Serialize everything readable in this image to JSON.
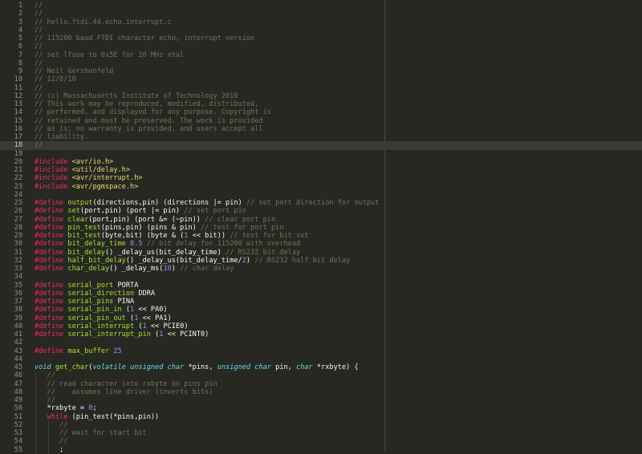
{
  "editor": {
    "theme_colors": {
      "background": "#272822",
      "comment": "#75715e",
      "keyword": "#f92672",
      "string": "#e6db74",
      "function": "#a6e22e",
      "number": "#ae81ff",
      "type": "#66d9ef",
      "text": "#f8f8f2"
    },
    "active_line": 18,
    "lines": [
      {
        "n": "1",
        "t": [
          [
            "c",
            "//"
          ]
        ]
      },
      {
        "n": "2",
        "t": [
          [
            "c",
            "//"
          ]
        ]
      },
      {
        "n": "3",
        "t": [
          [
            "c",
            "// hello.ftdi.44.echo.interrupt.c"
          ]
        ]
      },
      {
        "n": "4",
        "t": [
          [
            "c",
            "//"
          ]
        ]
      },
      {
        "n": "5",
        "t": [
          [
            "c",
            "// 115200 baud FTDI character echo, interrupt version"
          ]
        ]
      },
      {
        "n": "6",
        "t": [
          [
            "c",
            "//"
          ]
        ]
      },
      {
        "n": "7",
        "t": [
          [
            "c",
            "// set lfuse to 0x5E for 20 MHz xtal"
          ]
        ]
      },
      {
        "n": "8",
        "t": [
          [
            "c",
            "//"
          ]
        ]
      },
      {
        "n": "9",
        "t": [
          [
            "c",
            "// Neil Gershenfeld"
          ]
        ]
      },
      {
        "n": "10",
        "t": [
          [
            "c",
            "// 12/8/10"
          ]
        ]
      },
      {
        "n": "11",
        "t": [
          [
            "c",
            "//"
          ]
        ]
      },
      {
        "n": "12",
        "t": [
          [
            "c",
            "// (c) Massachusetts Institute of Technology 2010"
          ]
        ]
      },
      {
        "n": "13",
        "t": [
          [
            "c",
            "// This work may be reproduced, modified, distributed,"
          ]
        ]
      },
      {
        "n": "14",
        "t": [
          [
            "c",
            "// performed, and displayed for any purpose. Copyright is"
          ]
        ]
      },
      {
        "n": "15",
        "t": [
          [
            "c",
            "// retained and must be preserved. The work is provided"
          ]
        ]
      },
      {
        "n": "16",
        "t": [
          [
            "c",
            "// as is; no warranty is provided, and users accept all"
          ]
        ]
      },
      {
        "n": "17",
        "t": [
          [
            "c",
            "// liability."
          ]
        ]
      },
      {
        "n": "18",
        "t": [
          [
            "c",
            "//"
          ]
        ]
      },
      {
        "n": "19",
        "t": []
      },
      {
        "n": "20",
        "t": [
          [
            "k",
            "#include"
          ],
          [
            "p",
            " "
          ],
          [
            "s",
            "<avr/io.h>"
          ]
        ]
      },
      {
        "n": "21",
        "t": [
          [
            "k",
            "#include"
          ],
          [
            "p",
            " "
          ],
          [
            "s",
            "<util/delay.h>"
          ]
        ]
      },
      {
        "n": "22",
        "t": [
          [
            "k",
            "#include"
          ],
          [
            "p",
            " "
          ],
          [
            "s",
            "<avr/interrupt.h>"
          ]
        ]
      },
      {
        "n": "23",
        "t": [
          [
            "k",
            "#include"
          ],
          [
            "p",
            " "
          ],
          [
            "s",
            "<avr/pgmspace.h>"
          ]
        ]
      },
      {
        "n": "24",
        "t": []
      },
      {
        "n": "25",
        "t": [
          [
            "k",
            "#define"
          ],
          [
            "p",
            " "
          ],
          [
            "f",
            "output"
          ],
          [
            "p",
            "(directions,pin) (directions |= pin) "
          ],
          [
            "c",
            "// set port direction for output"
          ]
        ]
      },
      {
        "n": "26",
        "t": [
          [
            "k",
            "#define"
          ],
          [
            "p",
            " "
          ],
          [
            "f",
            "set"
          ],
          [
            "p",
            "(port,pin) (port |= pin) "
          ],
          [
            "c",
            "// set port pin"
          ]
        ]
      },
      {
        "n": "27",
        "t": [
          [
            "k",
            "#define"
          ],
          [
            "p",
            " "
          ],
          [
            "f",
            "clear"
          ],
          [
            "p",
            "(port,pin) (port &= (~pin)) "
          ],
          [
            "c",
            "// clear port pin"
          ]
        ]
      },
      {
        "n": "28",
        "t": [
          [
            "k",
            "#define"
          ],
          [
            "p",
            " "
          ],
          [
            "f",
            "pin_test"
          ],
          [
            "p",
            "(pins,pin) (pins & pin) "
          ],
          [
            "c",
            "// test for port pin"
          ]
        ]
      },
      {
        "n": "29",
        "t": [
          [
            "k",
            "#define"
          ],
          [
            "p",
            " "
          ],
          [
            "f",
            "bit_test"
          ],
          [
            "p",
            "(byte,bit) (byte & ("
          ],
          [
            "n",
            "1"
          ],
          [
            "p",
            " << bit)) "
          ],
          [
            "c",
            "// test for bit set"
          ]
        ]
      },
      {
        "n": "30",
        "t": [
          [
            "k",
            "#define"
          ],
          [
            "p",
            " "
          ],
          [
            "f",
            "bit_delay_time"
          ],
          [
            "p",
            " "
          ],
          [
            "n",
            "8.5"
          ],
          [
            "p",
            " "
          ],
          [
            "c",
            "// bit delay for 115200 with overhead"
          ]
        ]
      },
      {
        "n": "31",
        "t": [
          [
            "k",
            "#define"
          ],
          [
            "p",
            " "
          ],
          [
            "f",
            "bit_delay"
          ],
          [
            "p",
            "() _delay_us(bit_delay_time) "
          ],
          [
            "c",
            "// RS232 bit delay"
          ]
        ]
      },
      {
        "n": "32",
        "t": [
          [
            "k",
            "#define"
          ],
          [
            "p",
            " "
          ],
          [
            "f",
            "half_bit_delay"
          ],
          [
            "p",
            "() _delay_us(bit_delay_time/"
          ],
          [
            "n",
            "2"
          ],
          [
            "p",
            ") "
          ],
          [
            "c",
            "// RS232 half bit delay"
          ]
        ]
      },
      {
        "n": "33",
        "t": [
          [
            "k",
            "#define"
          ],
          [
            "p",
            " "
          ],
          [
            "f",
            "char_delay"
          ],
          [
            "p",
            "() _delay_ms("
          ],
          [
            "n",
            "10"
          ],
          [
            "p",
            ") "
          ],
          [
            "c",
            "// char delay"
          ]
        ]
      },
      {
        "n": "34",
        "t": []
      },
      {
        "n": "35",
        "t": [
          [
            "k",
            "#define"
          ],
          [
            "p",
            " "
          ],
          [
            "f",
            "serial_port"
          ],
          [
            "p",
            " PORTA"
          ]
        ]
      },
      {
        "n": "36",
        "t": [
          [
            "k",
            "#define"
          ],
          [
            "p",
            " "
          ],
          [
            "f",
            "serial_direction"
          ],
          [
            "p",
            " DDRA"
          ]
        ]
      },
      {
        "n": "37",
        "t": [
          [
            "k",
            "#define"
          ],
          [
            "p",
            " "
          ],
          [
            "f",
            "serial_pins"
          ],
          [
            "p",
            " PINA"
          ]
        ]
      },
      {
        "n": "38",
        "t": [
          [
            "k",
            "#define"
          ],
          [
            "p",
            " "
          ],
          [
            "f",
            "serial_pin_in"
          ],
          [
            "p",
            " ("
          ],
          [
            "n",
            "1"
          ],
          [
            "p",
            " << PA0)"
          ]
        ]
      },
      {
        "n": "39",
        "t": [
          [
            "k",
            "#define"
          ],
          [
            "p",
            " "
          ],
          [
            "f",
            "serial_pin_out"
          ],
          [
            "p",
            " ("
          ],
          [
            "n",
            "1"
          ],
          [
            "p",
            " << PA1)"
          ]
        ]
      },
      {
        "n": "40",
        "t": [
          [
            "k",
            "#define"
          ],
          [
            "p",
            " "
          ],
          [
            "f",
            "serial_interrupt"
          ],
          [
            "p",
            " ("
          ],
          [
            "n",
            "1"
          ],
          [
            "p",
            " << PCIE0)"
          ]
        ]
      },
      {
        "n": "41",
        "t": [
          [
            "k",
            "#define"
          ],
          [
            "p",
            " "
          ],
          [
            "f",
            "serial_interrupt_pin"
          ],
          [
            "p",
            " ("
          ],
          [
            "n",
            "1"
          ],
          [
            "p",
            " << PCINT0)"
          ]
        ]
      },
      {
        "n": "42",
        "t": []
      },
      {
        "n": "43",
        "t": [
          [
            "k",
            "#define"
          ],
          [
            "p",
            " "
          ],
          [
            "f",
            "max_buffer"
          ],
          [
            "p",
            " "
          ],
          [
            "n",
            "25"
          ]
        ]
      },
      {
        "n": "44",
        "t": []
      },
      {
        "n": "45",
        "t": [
          [
            "t",
            "void"
          ],
          [
            "p",
            " "
          ],
          [
            "f",
            "get_char"
          ],
          [
            "p",
            "("
          ],
          [
            "t",
            "volatile unsigned char"
          ],
          [
            "p",
            " *pins, "
          ],
          [
            "t",
            "unsigned char"
          ],
          [
            "p",
            " pin, "
          ],
          [
            "t",
            "char"
          ],
          [
            "p",
            " *rxbyte) {"
          ]
        ]
      },
      {
        "n": "46",
        "t": [
          [
            "p",
            "   "
          ],
          [
            "c",
            "//"
          ]
        ]
      },
      {
        "n": "47",
        "t": [
          [
            "p",
            "   "
          ],
          [
            "c",
            "// read character into rxbyte on pins pin"
          ]
        ]
      },
      {
        "n": "48",
        "t": [
          [
            "p",
            "   "
          ],
          [
            "c",
            "//    assumes line driver (inverts bits)"
          ]
        ]
      },
      {
        "n": "49",
        "t": [
          [
            "p",
            "   "
          ],
          [
            "c",
            "//"
          ]
        ]
      },
      {
        "n": "50",
        "t": [
          [
            "p",
            "   *rxbyte = "
          ],
          [
            "n",
            "0"
          ],
          [
            "p",
            ";"
          ]
        ]
      },
      {
        "n": "51",
        "t": [
          [
            "p",
            "   "
          ],
          [
            "k",
            "while"
          ],
          [
            "p",
            " (pin_test(*pins,pin))"
          ]
        ]
      },
      {
        "n": "52",
        "t": [
          [
            "p",
            "      "
          ],
          [
            "c",
            "//"
          ]
        ]
      },
      {
        "n": "53",
        "t": [
          [
            "p",
            "      "
          ],
          [
            "c",
            "// wait for start bit"
          ]
        ]
      },
      {
        "n": "54",
        "t": [
          [
            "p",
            "      "
          ],
          [
            "c",
            "//"
          ]
        ]
      },
      {
        "n": "55",
        "t": [
          [
            "p",
            "      ;"
          ]
        ]
      }
    ]
  }
}
